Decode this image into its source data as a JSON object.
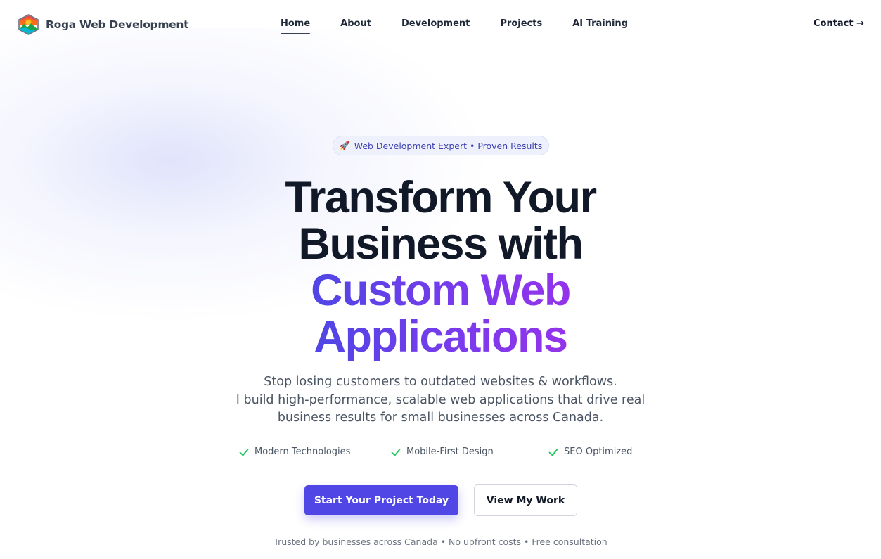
{
  "brand": {
    "name": "Roga Web Development",
    "logo_icon": "mountain-sun-hexagon-logo"
  },
  "nav": {
    "links": [
      {
        "label": "Home",
        "active": true
      },
      {
        "label": "About",
        "active": false
      },
      {
        "label": "Development",
        "active": false
      },
      {
        "label": "Projects",
        "active": false
      },
      {
        "label": "AI Training",
        "active": false
      }
    ],
    "contact_label": "Contact →"
  },
  "hero": {
    "badge_icon": "🚀",
    "badge_text": "Web Development Expert • Proven Results",
    "headline_lines": [
      "Transform Your",
      "Business with",
      "Custom Web",
      "Applications"
    ],
    "subtitle_lines": [
      "Stop losing customers to outdated websites & workflows.",
      "I build high-performance, scalable web applications that drive real",
      "business results for small businesses across Canada."
    ],
    "features": [
      {
        "label": "Modern Technologies",
        "icon": "check-icon"
      },
      {
        "label": "Mobile-First Design",
        "icon": "check-icon"
      },
      {
        "label": "SEO Optimized",
        "icon": "check-icon"
      }
    ],
    "primary_button": "Start Your Project Today",
    "secondary_button": "View My Work",
    "trust_text": "Trusted by businesses across Canada • No upfront costs • Free consultation"
  },
  "colors": {
    "accent": "#4f46e5",
    "gradient_end": "#9333ea",
    "check_green": "#22c55e",
    "heading_dark": "#111827"
  }
}
